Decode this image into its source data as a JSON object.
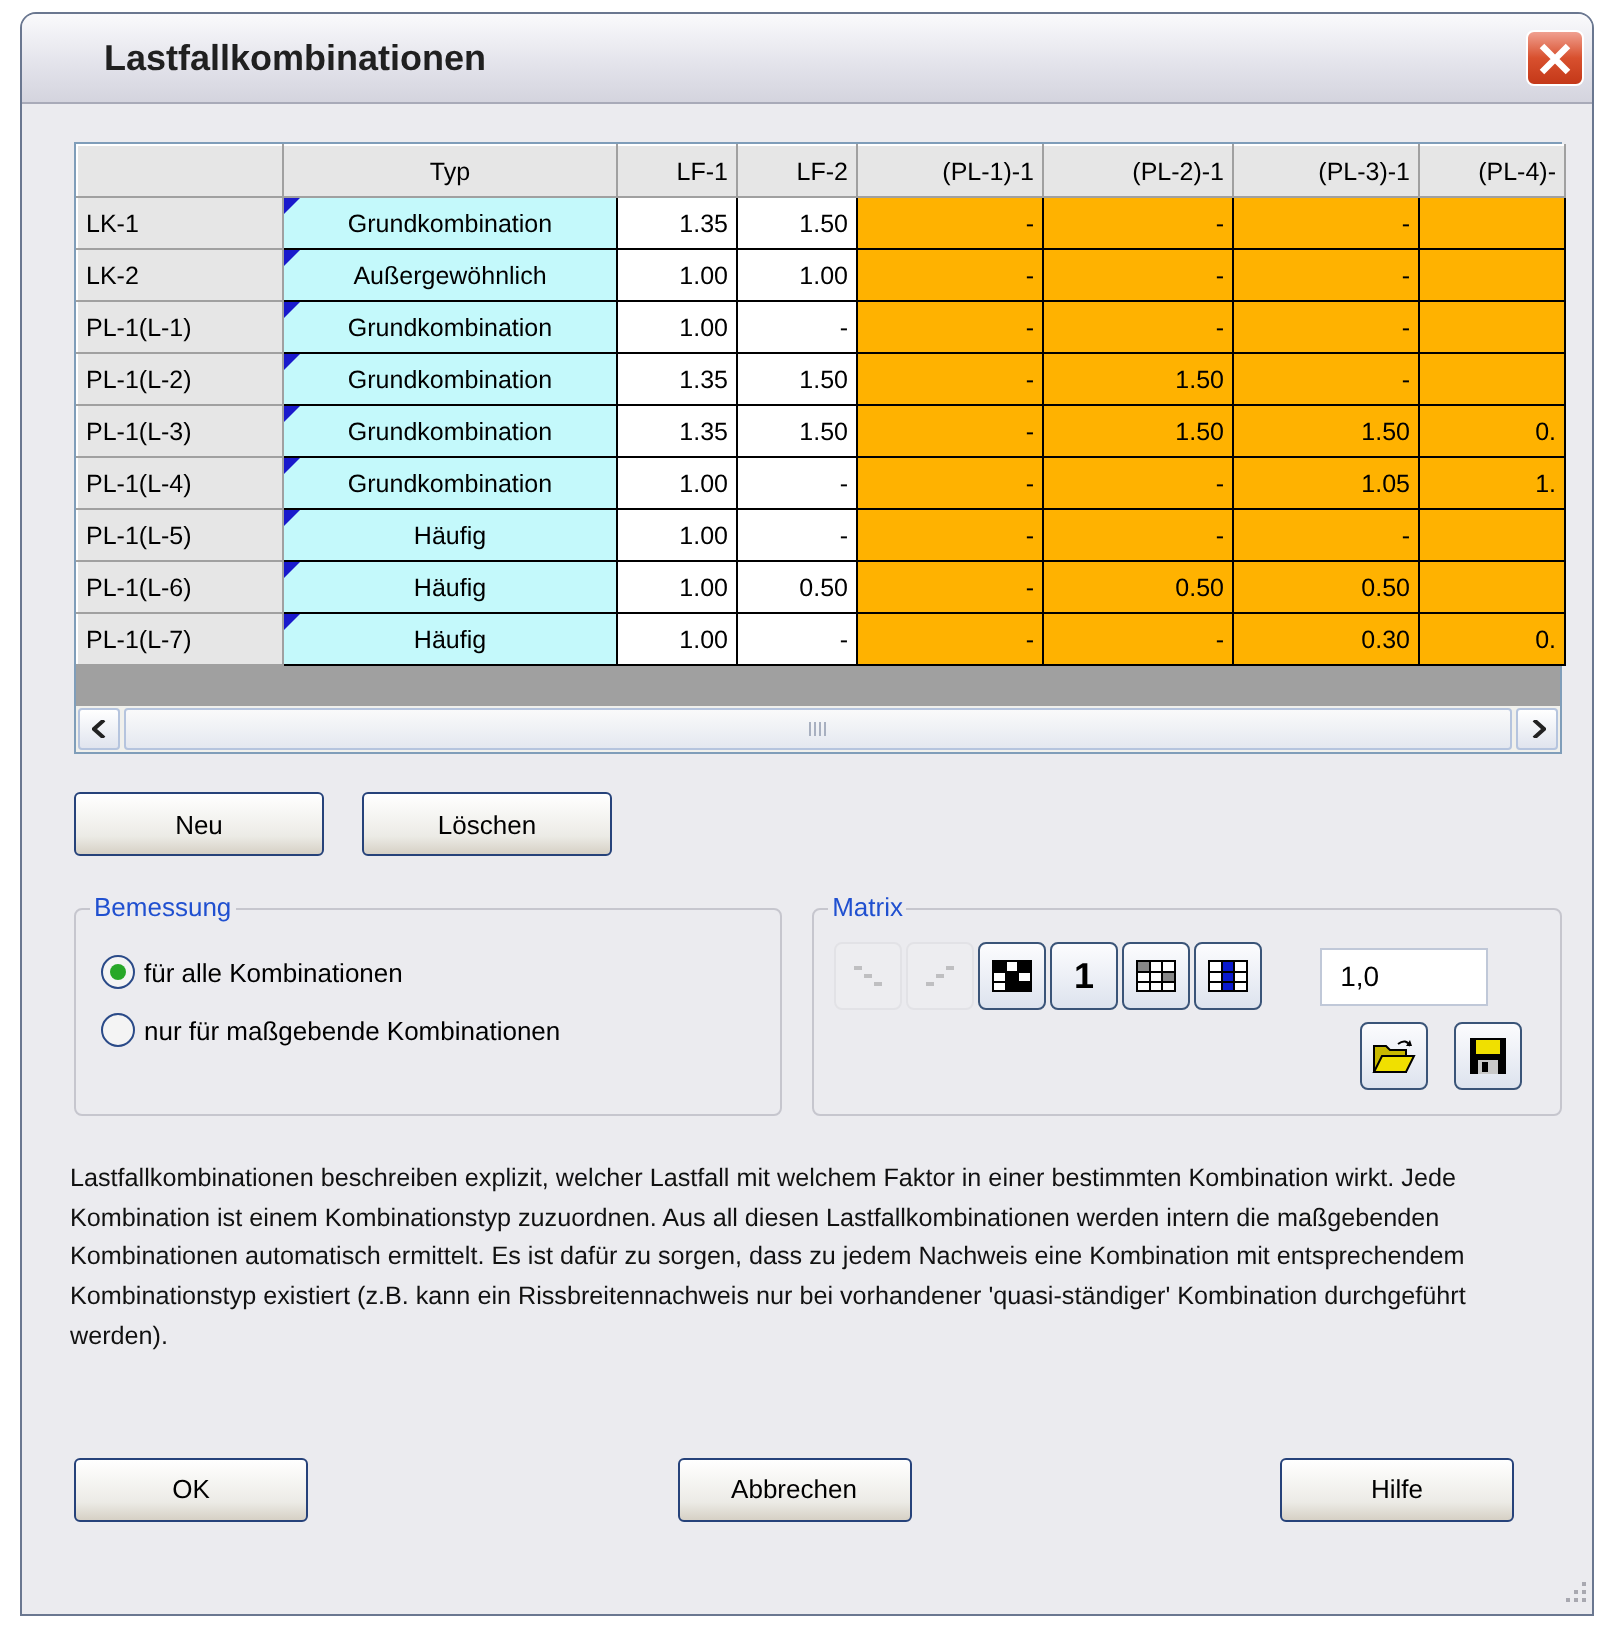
{
  "window": {
    "title": "Lastfallkombinationen"
  },
  "table": {
    "columns": [
      {
        "label": "Typ",
        "kind": "type"
      },
      {
        "label": "LF-1",
        "kind": "factor"
      },
      {
        "label": "LF-2",
        "kind": "factor"
      },
      {
        "label": "(PL-1)-1",
        "kind": "combination"
      },
      {
        "label": "(PL-2)-1",
        "kind": "combination"
      },
      {
        "label": "(PL-3)-1",
        "kind": "combination"
      },
      {
        "label": "(PL-4)-",
        "kind": "combination"
      }
    ],
    "rows": [
      {
        "label": "LK-1",
        "cells": [
          "Grundkombination",
          "1.35",
          "1.50",
          "-",
          "-",
          "-",
          null
        ]
      },
      {
        "label": "LK-2",
        "cells": [
          "Außergewöhnlich",
          "1.00",
          "1.00",
          "-",
          "-",
          "-",
          null
        ]
      },
      {
        "label": "PL-1(L-1)",
        "cells": [
          "Grundkombination",
          "1.00",
          "-",
          "-",
          "-",
          "-",
          null
        ]
      },
      {
        "label": "PL-1(L-2)",
        "cells": [
          "Grundkombination",
          "1.35",
          "1.50",
          "-",
          "1.50",
          "-",
          null
        ]
      },
      {
        "label": "PL-1(L-3)",
        "cells": [
          "Grundkombination",
          "1.35",
          "1.50",
          "-",
          "1.50",
          "1.50",
          "0."
        ]
      },
      {
        "label": "PL-1(L-4)",
        "cells": [
          "Grundkombination",
          "1.00",
          "-",
          "-",
          "-",
          "1.05",
          "1."
        ]
      },
      {
        "label": "PL-1(L-5)",
        "cells": [
          "Häufig",
          "1.00",
          "-",
          "-",
          "-",
          "-",
          null
        ]
      },
      {
        "label": "PL-1(L-6)",
        "cells": [
          "Häufig",
          "1.00",
          "0.50",
          "-",
          "0.50",
          "0.50",
          null
        ]
      },
      {
        "label": "PL-1(L-7)",
        "cells": [
          "Häufig",
          "1.00",
          "-",
          "-",
          "-",
          "0.30",
          "0."
        ]
      }
    ]
  },
  "row_buttons": [
    "Neu",
    "Löschen"
  ],
  "bemessung": {
    "title": "Bemessung",
    "options": [
      {
        "label": "für alle Kombinationen",
        "selected": true
      },
      {
        "label": "nur für maßgebende Kombinationen",
        "selected": false
      }
    ]
  },
  "matrix": {
    "title": "Matrix",
    "tools": [
      {
        "kind": "diag_down",
        "disabled": true
      },
      {
        "kind": "diag_up",
        "disabled": true
      },
      {
        "kind": "checker",
        "disabled": false
      },
      {
        "kind": "one",
        "text": "1",
        "disabled": false
      },
      {
        "kind": "grid",
        "disabled": false
      },
      {
        "kind": "column",
        "disabled": false
      }
    ],
    "value": "1,0",
    "file_buttons": [
      {
        "kind": "open"
      },
      {
        "kind": "save"
      }
    ]
  },
  "description": "Lastfallkombinationen beschreiben explizit, welcher Lastfall mit welchem Faktor in einer bestimmten Kombination wirkt. Jede Kombination ist einem Kombinationstyp zuzuordnen. Aus all diesen Lastfallkombinationen werden intern die maßgebenden Kombinationen automatisch ermittelt. Es ist dafür zu sorgen, dass zu jedem Nachweis eine Kombination mit entsprechendem Kombinationstyp existiert (z.B. kann ein Rissbreitennachweis nur bei vorhandener 'quasi-ständiger' Kombination durchgeführt werden).",
  "dialog_buttons": [
    "OK",
    "Abbrechen",
    "Hilfe"
  ]
}
